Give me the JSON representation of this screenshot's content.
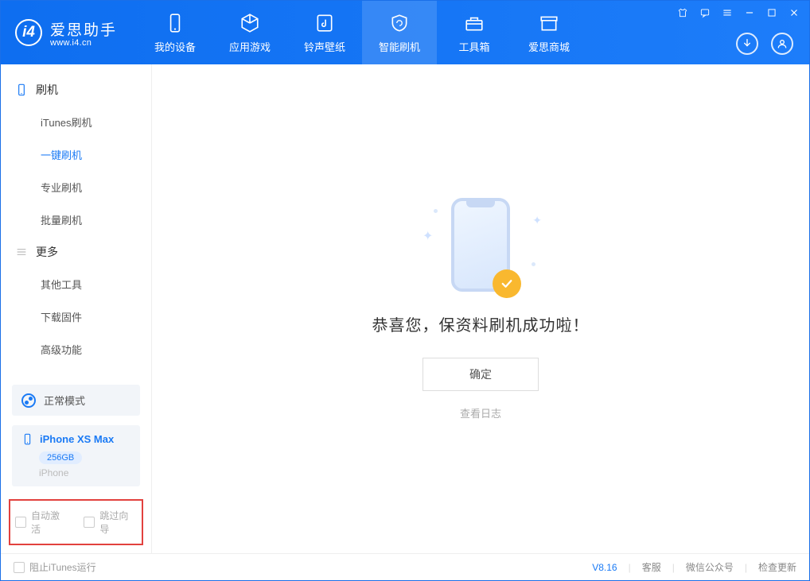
{
  "brand": {
    "name": "爱思助手",
    "url": "www.i4.cn"
  },
  "tabs": [
    {
      "label": "我的设备"
    },
    {
      "label": "应用游戏"
    },
    {
      "label": "铃声壁纸"
    },
    {
      "label": "智能刷机"
    },
    {
      "label": "工具箱"
    },
    {
      "label": "爱思商城"
    }
  ],
  "sidebar": {
    "section_flash": "刷机",
    "items_flash": [
      "iTunes刷机",
      "一键刷机",
      "专业刷机",
      "批量刷机"
    ],
    "section_more": "更多",
    "items_more": [
      "其他工具",
      "下载固件",
      "高级功能"
    ]
  },
  "mode": {
    "label": "正常模式"
  },
  "device": {
    "name": "iPhone XS Max",
    "storage": "256GB",
    "type": "iPhone"
  },
  "options": {
    "auto_activate": "自动激活",
    "skip_guide": "跳过向导"
  },
  "main": {
    "message": "恭喜您，保资料刷机成功啦！",
    "confirm": "确定",
    "view_log": "查看日志"
  },
  "statusbar": {
    "block_itunes": "阻止iTunes运行",
    "version": "V8.16",
    "support": "客服",
    "wechat": "微信公众号",
    "check_update": "检查更新"
  }
}
